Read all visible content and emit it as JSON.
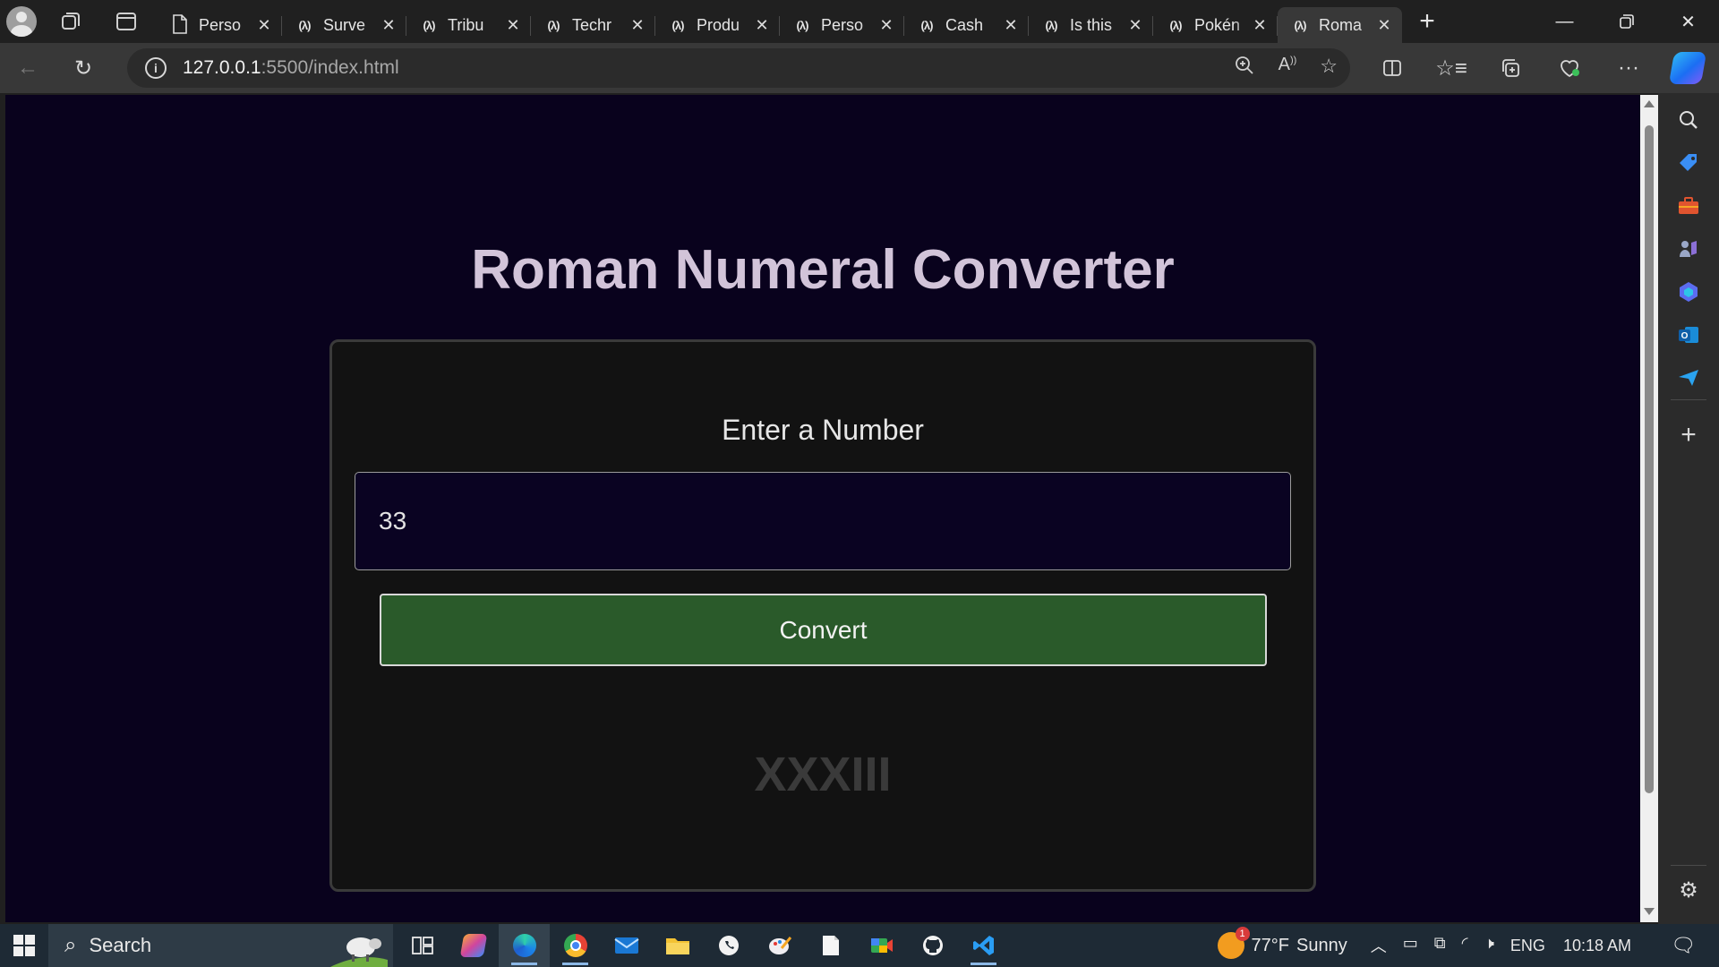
{
  "browser": {
    "tabs": [
      {
        "favicon": "page-icon",
        "title": "Perso",
        "active": false
      },
      {
        "favicon": "fcc-icon",
        "title": "Surve",
        "active": false
      },
      {
        "favicon": "fcc-icon",
        "title": "Tribu",
        "active": false
      },
      {
        "favicon": "fcc-icon",
        "title": "Techr",
        "active": false
      },
      {
        "favicon": "fcc-icon",
        "title": "Produ",
        "active": false
      },
      {
        "favicon": "fcc-icon",
        "title": "Perso",
        "active": false
      },
      {
        "favicon": "fcc-icon",
        "title": "Cash",
        "active": false
      },
      {
        "favicon": "fcc-icon",
        "title": "Is this",
        "active": false
      },
      {
        "favicon": "fcc-icon",
        "title": "Pokén",
        "active": false
      },
      {
        "favicon": "fcc-icon",
        "title": "Roma",
        "active": true
      }
    ],
    "address": {
      "host": "127.0.0.1",
      "path": ":5500/index.html"
    }
  },
  "page": {
    "title": "Roman Numeral Converter",
    "input_label": "Enter a Number",
    "input_value": "33",
    "button_label": "Convert",
    "output": "XXXIII",
    "colors": {
      "background": "#09021d",
      "card": "#121212",
      "button": "#2a5a2a",
      "title": "#d2c4d9"
    }
  },
  "taskbar": {
    "search_placeholder": "Search",
    "weather": {
      "temp": "77°F",
      "condition": "Sunny",
      "badge": "1"
    },
    "language": "ENG",
    "time": "10:18 AM",
    "apps": [
      "task-view-icon",
      "copilot-icon",
      "edge-icon",
      "chrome-icon",
      "mail-icon",
      "file-explorer-icon",
      "whatsapp-icon",
      "paint-icon",
      "notepad-icon",
      "meet-icon",
      "github-icon",
      "vscode-icon"
    ]
  }
}
